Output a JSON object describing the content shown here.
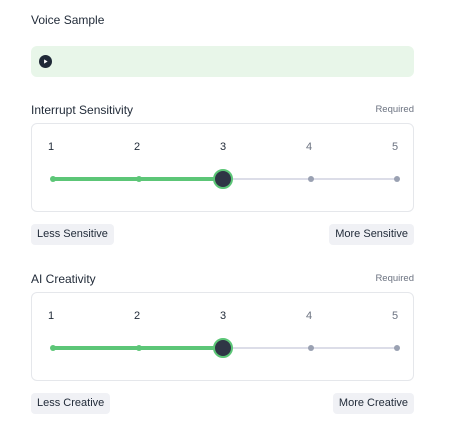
{
  "voice_sample": {
    "title": "Voice Sample",
    "play_icon": "play-icon"
  },
  "interrupt": {
    "title": "Interrupt Sensitivity",
    "required": "Required",
    "ticks": [
      "1",
      "2",
      "3",
      "4",
      "5"
    ],
    "selected": 3,
    "min_label": "Less Sensitive",
    "max_label": "More Sensitive"
  },
  "creativity": {
    "title": "AI Creativity",
    "required": "Required",
    "ticks": [
      "1",
      "2",
      "3",
      "4",
      "5"
    ],
    "selected": 3,
    "min_label": "Less Creative",
    "max_label": "More Creative"
  },
  "colors": {
    "accent": "#5cc677",
    "thumb": "#2f3545",
    "voice_bg": "#e8f6e9"
  }
}
